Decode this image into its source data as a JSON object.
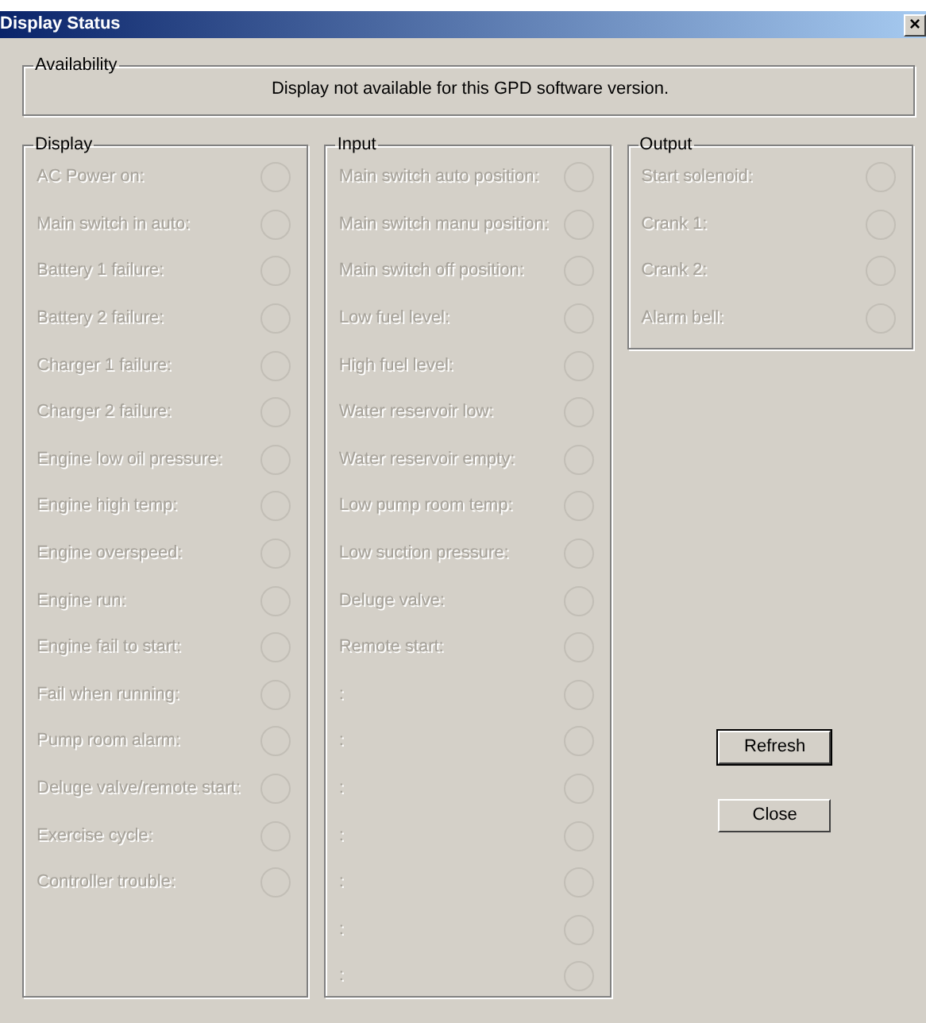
{
  "window": {
    "title": "Display Status",
    "close_glyph": "×"
  },
  "availability": {
    "title": "Availability",
    "message": "Display not available for this GPD software version."
  },
  "groups": [
    {
      "title": "Display",
      "items": [
        {
          "label": "AC Power on:",
          "disabled": true
        },
        {
          "label": "Main switch in auto:",
          "disabled": true
        },
        {
          "label": "Battery 1 failure:",
          "disabled": true
        },
        {
          "label": "Battery 2 failure:",
          "disabled": true
        },
        {
          "label": "Charger 1 failure:",
          "disabled": true
        },
        {
          "label": "Charger 2 failure:",
          "disabled": true
        },
        {
          "label": "Engine low oil pressure:",
          "disabled": true
        },
        {
          "label": "Engine high temp:",
          "disabled": true
        },
        {
          "label": "Engine overspeed:",
          "disabled": true
        },
        {
          "label": "Engine run:",
          "disabled": true
        },
        {
          "label": "Engine fail to start:",
          "disabled": true
        },
        {
          "label": "Fail when running:",
          "disabled": true
        },
        {
          "label": "Pump room alarm:",
          "disabled": true
        },
        {
          "label": "Deluge valve/remote start:",
          "disabled": true
        },
        {
          "label": "Exercise cycle:",
          "disabled": true
        },
        {
          "label": "Controller trouble:",
          "disabled": true
        }
      ]
    },
    {
      "title": "Input",
      "items": [
        {
          "label": "Main switch auto position:",
          "disabled": true
        },
        {
          "label": "Main switch manu position:",
          "disabled": true
        },
        {
          "label": "Main switch off position:",
          "disabled": true
        },
        {
          "label": "Low fuel level:",
          "disabled": true
        },
        {
          "label": "High fuel level:",
          "disabled": true
        },
        {
          "label": "Water reservoir low:",
          "disabled": true
        },
        {
          "label": "Water reservoir empty:",
          "disabled": true
        },
        {
          "label": "Low pump room temp:",
          "disabled": true
        },
        {
          "label": "Low suction pressure:",
          "disabled": true
        },
        {
          "label": "Deluge valve:",
          "disabled": true
        },
        {
          "label": "Remote start:",
          "disabled": true
        },
        {
          "label": ":",
          "disabled": true
        },
        {
          "label": ":",
          "disabled": true
        },
        {
          "label": ":",
          "disabled": true
        },
        {
          "label": ":",
          "disabled": true
        },
        {
          "label": ":",
          "disabled": true
        },
        {
          "label": ":",
          "disabled": true
        },
        {
          "label": ":",
          "disabled": true
        }
      ]
    },
    {
      "title": "Output",
      "items": [
        {
          "label": "Start solenoid:",
          "disabled": true
        },
        {
          "label": "Crank 1:",
          "disabled": true
        },
        {
          "label": "Crank 2:",
          "disabled": true
        },
        {
          "label": "Alarm bell:",
          "disabled": true
        }
      ]
    }
  ],
  "buttons": [
    {
      "label": "Refresh",
      "default": true
    },
    {
      "label": "Close",
      "default": false
    }
  ]
}
